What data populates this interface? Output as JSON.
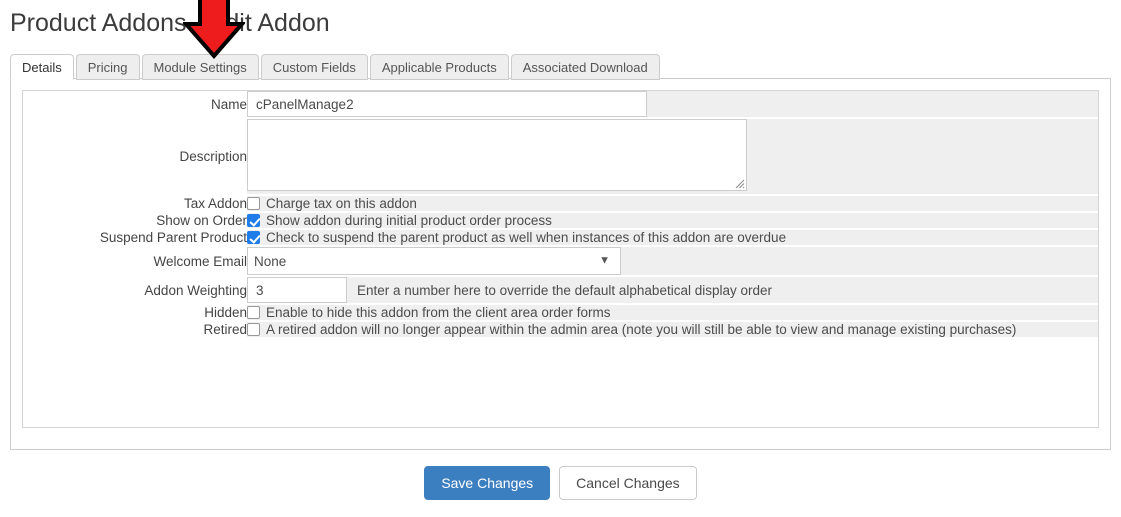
{
  "page": {
    "title": "Product Addons - Edit Addon"
  },
  "tabs": [
    {
      "label": "Details",
      "active": true
    },
    {
      "label": "Pricing",
      "active": false
    },
    {
      "label": "Module Settings",
      "active": false
    },
    {
      "label": "Custom Fields",
      "active": false
    },
    {
      "label": "Applicable Products",
      "active": false
    },
    {
      "label": "Associated Download",
      "active": false
    }
  ],
  "form": {
    "name": {
      "label": "Name",
      "value": "cPanelManage2",
      "placeholder": ""
    },
    "description": {
      "label": "Description",
      "value": "",
      "placeholder": ""
    },
    "tax_addon": {
      "label": "Tax Addon",
      "checkbox_label": "Charge tax on this addon",
      "checked": false
    },
    "show_on_order": {
      "label": "Show on Order",
      "checkbox_label": "Show addon during initial product order process",
      "checked": true
    },
    "suspend_parent_product": {
      "label": "Suspend Parent Product",
      "checkbox_label": "Check to suspend the parent product as well when instances of this addon are overdue",
      "checked": true
    },
    "welcome_email": {
      "label": "Welcome Email",
      "value": "None",
      "options": [
        "None"
      ]
    },
    "addon_weighting": {
      "label": "Addon Weighting",
      "value": "3",
      "hint": "Enter a number here to override the default alphabetical display order"
    },
    "hidden": {
      "label": "Hidden",
      "checkbox_label": "Enable to hide this addon from the client area order forms",
      "checked": false
    },
    "retired": {
      "label": "Retired",
      "checkbox_label": "A retired addon will no longer appear within the admin area (note you will still be able to view and manage existing purchases)",
      "checked": false
    }
  },
  "buttons": {
    "save": "Save Changes",
    "cancel": "Cancel Changes"
  },
  "annotation": {
    "arrow": {
      "name": "red-down-arrow",
      "fill": "#ee1c1c",
      "stroke": "#000000",
      "points_at": "Module Settings"
    }
  },
  "colors": {
    "accent_blue": "#3c7fc1",
    "checkbox_blue": "#1f7ce8",
    "row_gray": "#efefef",
    "border_gray": "#cccccc",
    "annotation_red": "#ee1c1c"
  }
}
